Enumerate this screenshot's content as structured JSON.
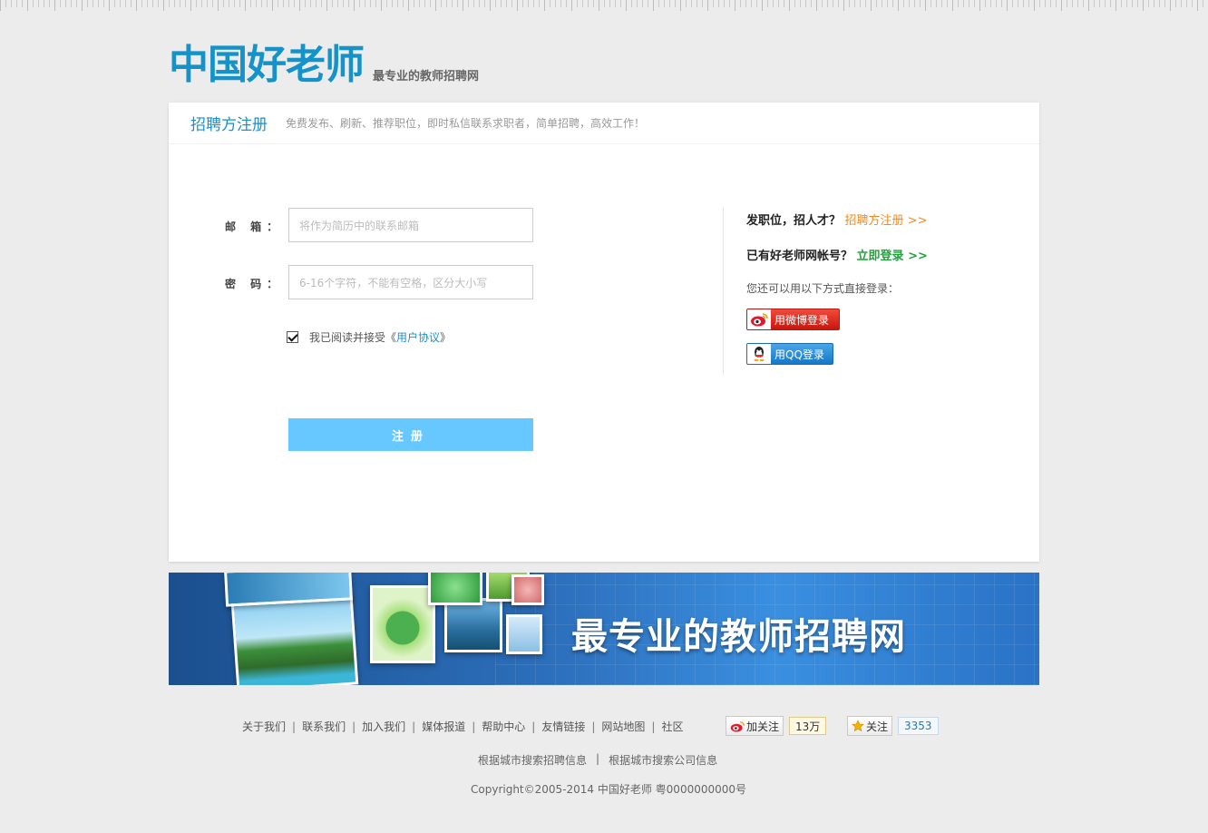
{
  "brand": {
    "logo_text": "中国好老师",
    "slogan": "最专业的教师招聘网"
  },
  "card": {
    "title": "招聘方注册",
    "subtitle": "免费发布、刷新、推荐职位，即时私信联系求职者，简单招聘，高效工作！"
  },
  "form": {
    "email_label": "邮 箱：",
    "email_placeholder": "将作为简历中的联系邮箱",
    "password_label": "密 码：",
    "password_placeholder": "6-16个字符，不能有空格，区分大小写",
    "agree_checked": true,
    "agree_text": "我已阅读并接受《",
    "agree_link": "用户协议",
    "agree_close": "》",
    "register_label": "注册"
  },
  "side": {
    "line1_text": "发职位，招人才？",
    "line1_link": "招聘方注册 >>",
    "line2_text": "已有好老师网帐号？",
    "line2_link": "立即登录 >>",
    "note": "您还可以用以下方式直接登录：",
    "weibo_label": "用微博登录",
    "qq_label": "用QQ登录"
  },
  "banner": {
    "title": "最专业的教师招聘网"
  },
  "footer": {
    "links": [
      "关于我们",
      "联系我们",
      "加入我们",
      "媒体报道",
      "帮助中心",
      "友情链接",
      "网站地图",
      "社区"
    ],
    "weibo_follow_label": "加关注",
    "weibo_follow_count": "13万",
    "qq_follow_label": "关注",
    "qq_follow_count": "3353",
    "search_links": [
      "根据城市搜索招聘信息",
      "根据城市搜索公司信息"
    ],
    "copyright": "Copyright©2005-2014 中国好老师 粤0000000000号"
  },
  "colors": {
    "brand_blue": "#1592c8",
    "register_button": "#66c8ff",
    "orange_link": "#f08a1e",
    "green_link": "#22a23d"
  }
}
